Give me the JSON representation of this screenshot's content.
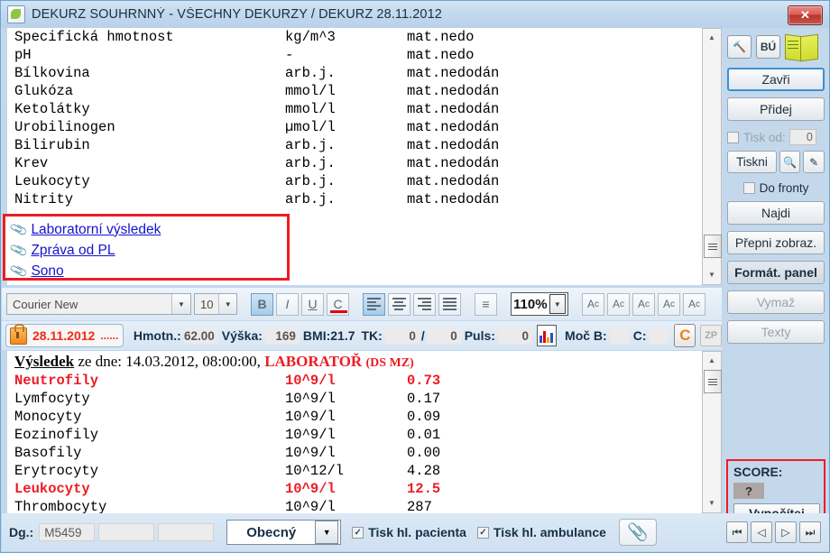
{
  "window": {
    "title": "DEKURZ SOUHRNNÝ - VŠECHNY DEKURZY / DEKURZ 28.11.2012",
    "close_label": "✕"
  },
  "upper_pane": {
    "rows": [
      {
        "name": "Specifická hmotnost",
        "unit": "kg/m^3",
        "value": "mat.nedo"
      },
      {
        "name": "pH",
        "unit": "-",
        "value": "mat.nedo"
      },
      {
        "name": "Bílkovina",
        "unit": "arb.j.",
        "value": "mat.nedodán"
      },
      {
        "name": "Glukóza",
        "unit": "mmol/l",
        "value": "mat.nedodán"
      },
      {
        "name": "Ketolátky",
        "unit": "mmol/l",
        "value": "mat.nedodán"
      },
      {
        "name": "Urobilinogen",
        "unit": "µmol/l",
        "value": "mat.nedodán"
      },
      {
        "name": "Bilirubin",
        "unit": "arb.j.",
        "value": "mat.nedodán"
      },
      {
        "name": "Krev",
        "unit": "arb.j.",
        "value": "mat.nedodán"
      },
      {
        "name": "Leukocyty",
        "unit": "arb.j.",
        "value": "mat.nedodán"
      },
      {
        "name": "Nitrity",
        "unit": "arb.j.",
        "value": "mat.nedodán"
      }
    ]
  },
  "attachments": {
    "items": [
      {
        "label": "Laboratorní výsledek"
      },
      {
        "label": "Zpráva od PL"
      },
      {
        "label": "Sono"
      }
    ],
    "clip_icon": "paperclip-icon",
    "highlight_color": "#ee1c24"
  },
  "toolbar": {
    "font_name": "Courier New",
    "font_size": "10",
    "bold": "B",
    "italic": "I",
    "underline": "U",
    "color": "C",
    "color_swatch": "#e2000f",
    "zoom": "110%",
    "bullets_icon": "bullet-list-icon",
    "align_left_icon": "align-left-icon",
    "align_center_icon": "align-center-icon",
    "align_right_icon": "align-right-icon",
    "align_justify_icon": "align-justify-icon",
    "spell_icons": [
      "spell-a1-icon",
      "spell-a2-icon",
      "spell-a3-icon",
      "spell-a4-icon",
      "spell-a5-icon"
    ]
  },
  "measure_bar": {
    "date": "28.11.2012",
    "date_dots": "......",
    "lock_icon": "lock-icon",
    "weight_label": "Hmotn.:",
    "weight_value": "62.00",
    "height_label": "Výška:",
    "height_value": "169",
    "bmi_label": "BMI:21.7",
    "tk_label": "TK:",
    "tk_systolic": "0",
    "tk_separator": "/",
    "tk_diastolic": "0",
    "pulse_label": "Puls:",
    "pulse_value": "0",
    "chart_icon": "bar-chart-icon",
    "urine_b_label": "Moč B:",
    "urine_b_value": "",
    "urine_c_label": "C:",
    "urine_c_value": "",
    "c_button": "c-circle-icon",
    "zp_button": "ZP"
  },
  "lower_pane": {
    "header": {
      "title": "Výsledek",
      "from_label": "ze dne:",
      "datetime": "14.03.2012, 08:00:00,",
      "lab_name": "LABORATOŘ",
      "lab_suffix": "(DS MZ)"
    },
    "rows": [
      {
        "name": "Neutrofily",
        "unit": "10^9/l",
        "value": "0.73",
        "highlight": true
      },
      {
        "name": "Lymfocyty",
        "unit": "10^9/l",
        "value": "0.17",
        "highlight": false
      },
      {
        "name": "Monocyty",
        "unit": "10^9/l",
        "value": "0.09",
        "highlight": false
      },
      {
        "name": "Eozinofily",
        "unit": "10^9/l",
        "value": "0.01",
        "highlight": false
      },
      {
        "name": "Basofily",
        "unit": "10^9/l",
        "value": "0.00",
        "highlight": false
      },
      {
        "name": "Erytrocyty",
        "unit": "10^12/l",
        "value": "4.28",
        "highlight": false
      },
      {
        "name": "Leukocyty",
        "unit": "10^9/l",
        "value": "12.5",
        "highlight": true
      },
      {
        "name": "Thrombocyty",
        "unit": "10^9/l",
        "value": "287",
        "highlight": false
      }
    ]
  },
  "sidebar": {
    "tool_icon": "hammer-icon",
    "bu_button": "BÚ",
    "book_icon": "book-icon",
    "buttons": [
      {
        "name": "close",
        "label": "Zavři",
        "accel": "Z"
      },
      {
        "name": "add",
        "label": "Přidej",
        "accel": "P"
      }
    ],
    "print_from_label": "Tisk od:",
    "print_from_value": "0",
    "print_button": "Tiskni",
    "preview_icon": "print-preview-icon",
    "signature_icon": "pen-icon",
    "queue_label": "Do fronty",
    "find_button": "Najdi",
    "switch_view_button": "Přepni zobraz.",
    "format_panel_button": "Formát. panel",
    "clear_button": "Vymaž",
    "texts_button": "Texty",
    "score": {
      "label": "SCORE:",
      "value": "?",
      "button": "Vypočítej"
    }
  },
  "bottom_bar": {
    "dg_label": "Dg.:",
    "dg_value_1": "M5459",
    "dg_value_2": "",
    "dg_value_3": "",
    "type_select": "Obecný",
    "print_patient_header": "Tisk hl. pacienta",
    "print_ambulance_header": "Tisk hl. ambulance",
    "attach_icon": "paperclip-icon",
    "nav_first": "⏮",
    "nav_prev": "◁",
    "nav_next": "▷",
    "nav_last": "⏭"
  }
}
